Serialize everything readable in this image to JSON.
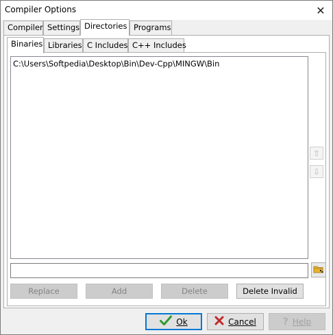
{
  "window": {
    "title": "Compiler Options"
  },
  "outer_tabs": [
    {
      "label": "Compiler"
    },
    {
      "label": "Settings"
    },
    {
      "label": "Directories"
    },
    {
      "label": "Programs"
    }
  ],
  "inner_tabs": [
    {
      "label": "Binaries"
    },
    {
      "label": "Libraries"
    },
    {
      "label": "C Includes"
    },
    {
      "label": "C++ Includes"
    }
  ],
  "directory_list": {
    "items": [
      "C:\\Users\\Softpedia\\Desktop\\Bin\\Dev-Cpp\\MINGW\\Bin"
    ]
  },
  "path_input": {
    "value": ""
  },
  "action_buttons": {
    "replace": "Replace",
    "add": "Add",
    "delete": "Delete",
    "delete_invalid": "Delete Invalid"
  },
  "dialog_buttons": {
    "ok": "Ok",
    "cancel": "Cancel",
    "help": "Help"
  },
  "icons": {
    "close": "close-icon",
    "move_up": "arrow-up-icon",
    "move_down": "arrow-down-icon",
    "browse": "folder-icon",
    "ok": "checkmark-icon",
    "cancel": "x-mark-icon",
    "help": "question-icon"
  },
  "colors": {
    "ok_check": "#2e9a2e",
    "cancel_x": "#c0282a",
    "folder": "#e8b531"
  }
}
